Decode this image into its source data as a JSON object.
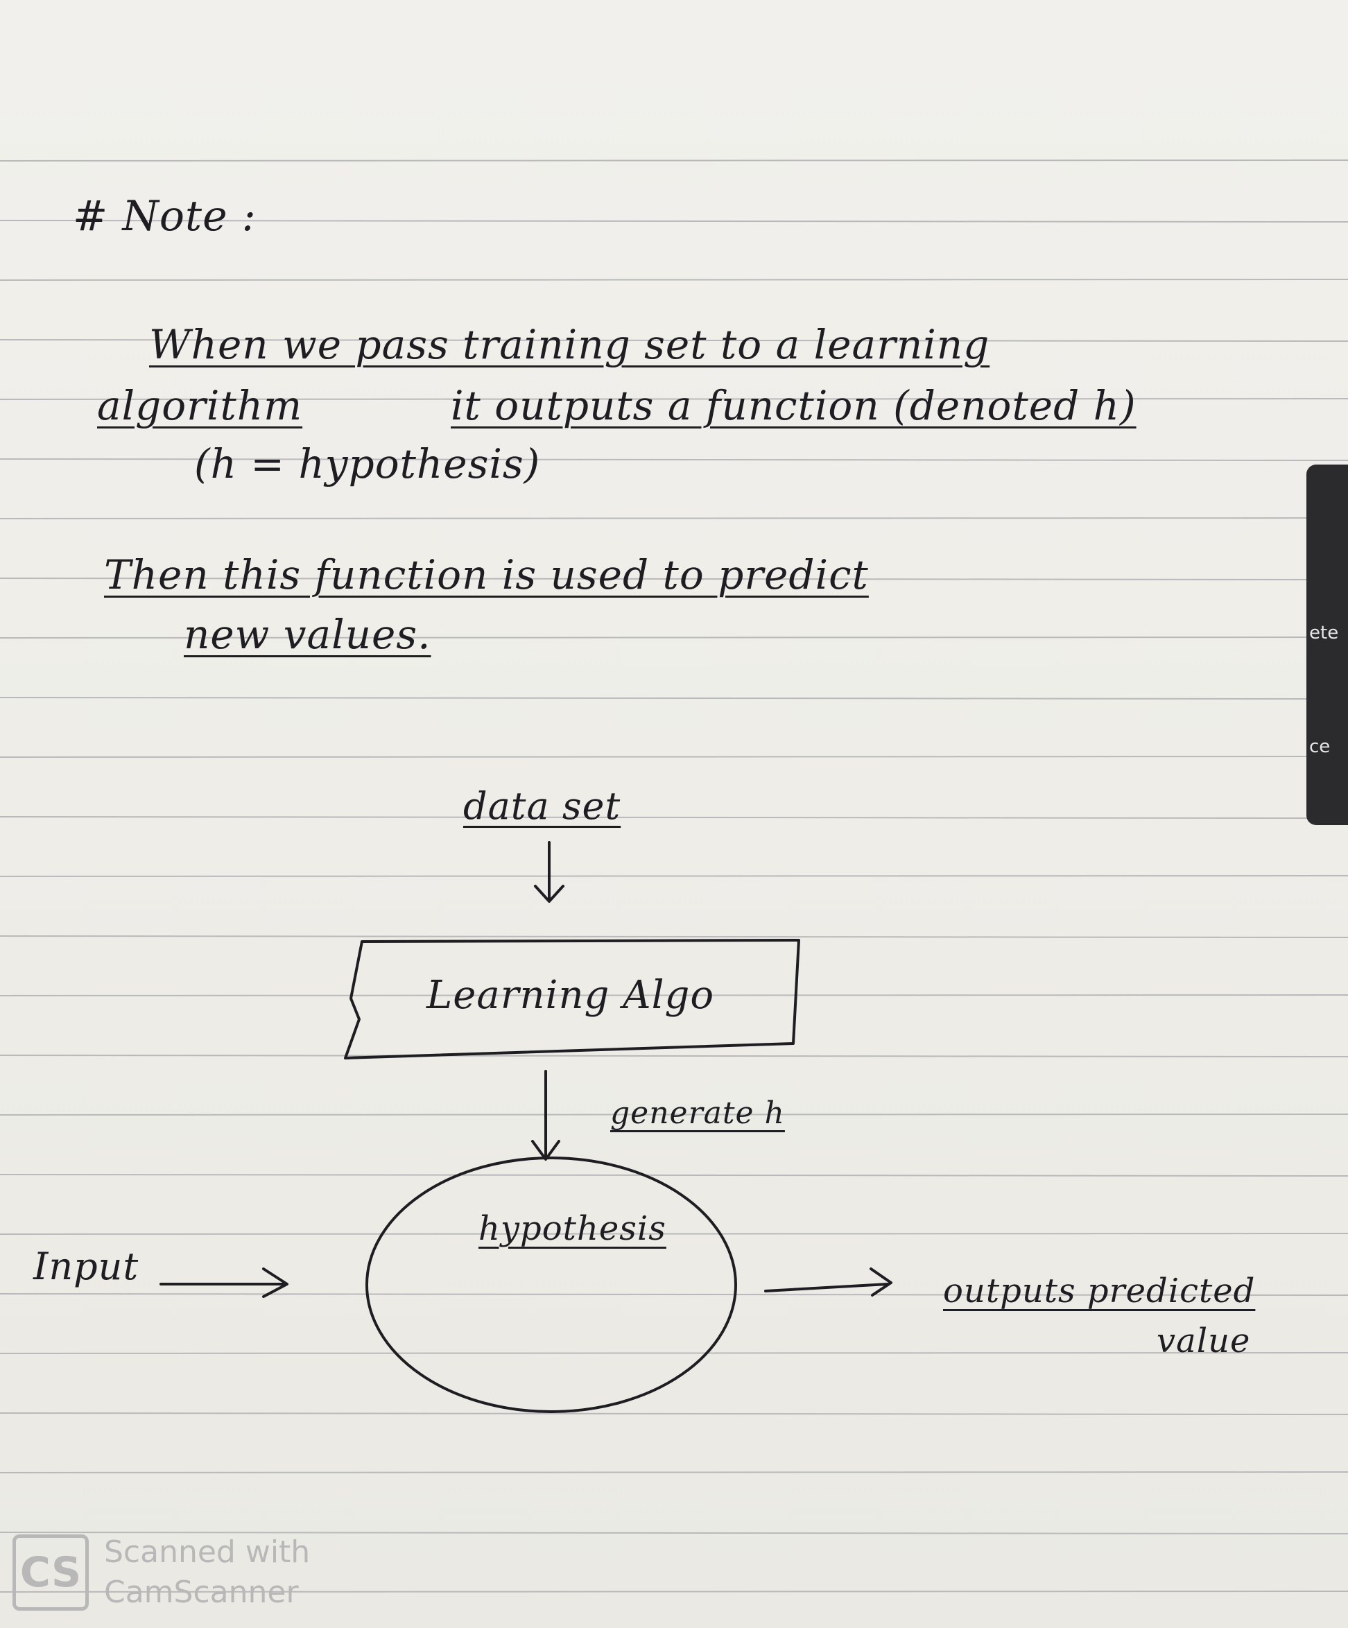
{
  "note": {
    "heading": "# Note :",
    "line1": "When we pass training set to a learning",
    "line2_a": "algorithm",
    "line2_b": "it outputs a function (denoted h)",
    "line3": "(h = hypothesis)",
    "line4": "Then this function is used to predict",
    "line5": "new values."
  },
  "diagram": {
    "dataset_label": "data set",
    "box_label": "Learning Algo",
    "generate_label": "generate h",
    "ellipse_label": "hypothesis",
    "input_label": "Input",
    "output_label_1": "outputs predicted",
    "output_label_2": "value"
  },
  "background": {
    "keyboard_key_1": "ete",
    "keyboard_key_2": "ce"
  },
  "watermark": {
    "logo": "CS",
    "line1": "Scanned with",
    "line2": "CamScanner"
  },
  "colors": {
    "ink": "#1d1d22",
    "rule": "#b9b9bb",
    "paper": "#eeede8",
    "watermark": "#b8b8b8"
  }
}
